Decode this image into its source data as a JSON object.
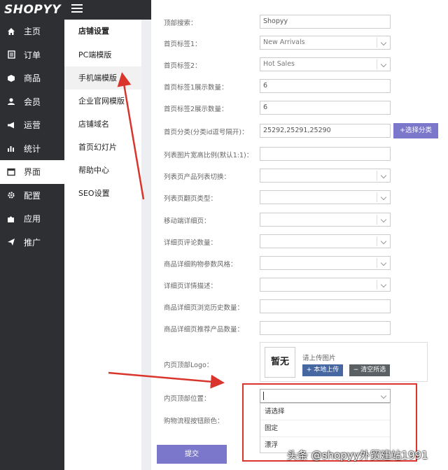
{
  "brand": {
    "logo": "SHOPYY"
  },
  "sidebar": {
    "items": [
      {
        "label": "主页",
        "icon": "home-icon"
      },
      {
        "label": "订单",
        "icon": "document-icon"
      },
      {
        "label": "商品",
        "icon": "box-icon"
      },
      {
        "label": "会员",
        "icon": "user-icon"
      },
      {
        "label": "运营",
        "icon": "megaphone-icon"
      },
      {
        "label": "统计",
        "icon": "bar-chart-icon"
      },
      {
        "label": "界面",
        "icon": "window-icon",
        "active": true
      },
      {
        "label": "配置",
        "icon": "gear-icon"
      },
      {
        "label": "应用",
        "icon": "puzzle-icon"
      },
      {
        "label": "推广",
        "icon": "send-icon"
      }
    ]
  },
  "submenu": {
    "title": "店铺设置",
    "items": [
      {
        "label": "PC端模版"
      },
      {
        "label": "手机端模版",
        "active": true
      },
      {
        "label": "企业官网模版"
      },
      {
        "label": "店铺域名"
      },
      {
        "label": "首页幻灯片"
      },
      {
        "label": "帮助中心"
      },
      {
        "label": "SEO设置"
      }
    ]
  },
  "form": {
    "rows": [
      {
        "label": "顶部搜索：",
        "value": "Shopyy",
        "type": "text"
      },
      {
        "label": "首页标签1：",
        "value": "New Arrivals",
        "type": "select"
      },
      {
        "label": "首页标签2：",
        "value": "Hot Sales",
        "type": "select"
      },
      {
        "label": "首页标签1展示数量：",
        "value": "6",
        "type": "text"
      },
      {
        "label": "首页标签2展示数量：",
        "value": "6",
        "type": "text"
      },
      {
        "label": "首页分类(分类id逗号隔开)：",
        "value": "25292,25291,25290",
        "type": "text"
      },
      {
        "label": "列表图片宽高比例(默认1:1)：",
        "value": "",
        "type": "text"
      },
      {
        "label": "列表页产品列表切换：",
        "value": "",
        "type": "select"
      },
      {
        "label": "列表页翻页类型：",
        "value": "",
        "type": "select"
      },
      {
        "label": "移动端详细页：",
        "value": "",
        "type": "select"
      },
      {
        "label": "详细页评论数量：",
        "value": "",
        "type": "select"
      },
      {
        "label": "商品详细购物参数风格：",
        "value": "",
        "type": "select"
      },
      {
        "label": "详细页详情描述：",
        "value": "",
        "type": "select"
      },
      {
        "label": "商品详细页浏览历史数量：",
        "value": "",
        "type": "text"
      },
      {
        "label": "商品详细页推荐产品数量：",
        "value": "",
        "type": "text"
      }
    ],
    "category_button": "+选择分类",
    "logo": {
      "label": "内页顶部Logo：",
      "thumb_text": "暂无",
      "hint": "请上传图片",
      "upload_button": "+ 本地上传",
      "clear_button": "− 清空所选"
    },
    "position": {
      "label": "内页顶部位置：",
      "options": [
        "请选择",
        "固定",
        "漂浮"
      ]
    },
    "cart_color_label": "购物流程按钮颜色：",
    "submit": "提交"
  },
  "watermark": "头条 @shopyy外贸建站1991",
  "colors": {
    "sidebar_bg": "#2d2f33",
    "accent": "#7b78cc",
    "annotation": "#d9352c"
  }
}
